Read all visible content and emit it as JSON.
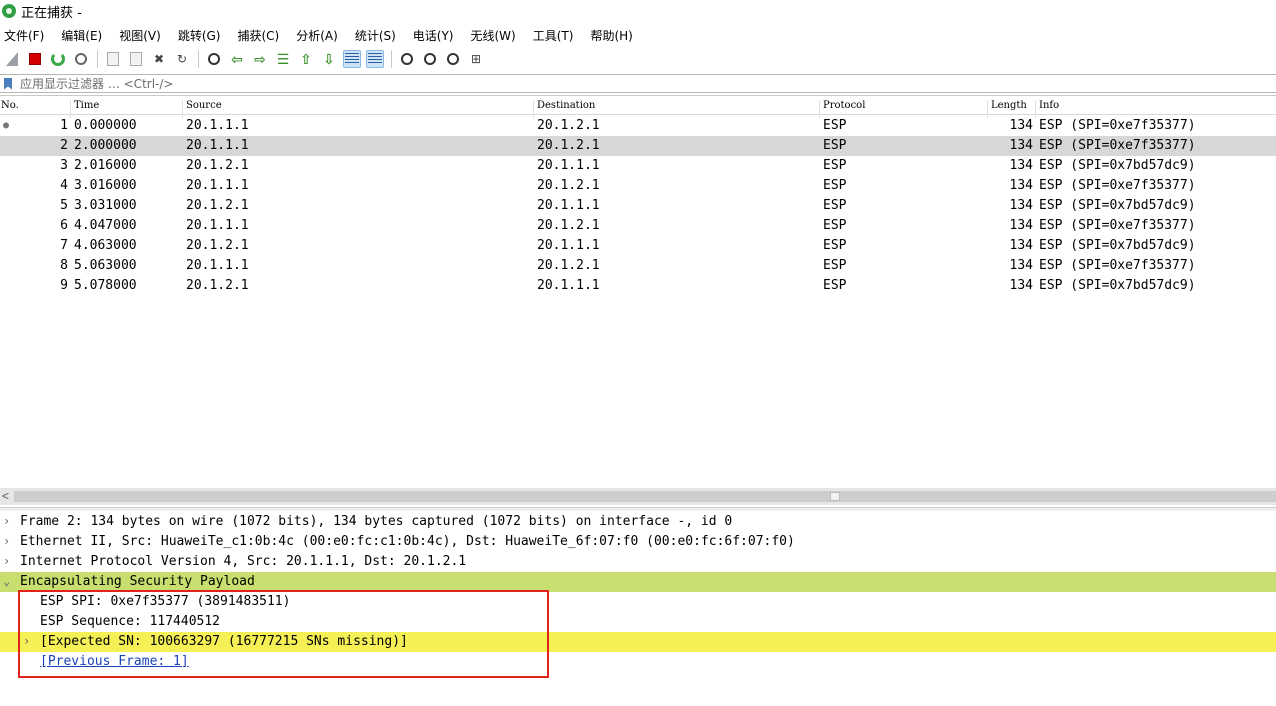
{
  "window": {
    "title": "正在捕获 -"
  },
  "menu": [
    "文件(F)",
    "编辑(E)",
    "视图(V)",
    "跳转(G)",
    "捕获(C)",
    "分析(A)",
    "统计(S)",
    "电话(Y)",
    "无线(W)",
    "工具(T)",
    "帮助(H)"
  ],
  "toolbar": {
    "icons": [
      "shark-fin-icon",
      "stop-capture-icon",
      "restart-capture-icon",
      "capture-options-icon",
      "open-file-icon",
      "save-file-icon",
      "close-file-icon",
      "reload-file-icon",
      "find-packet-icon",
      "go-back-icon",
      "go-forward-icon",
      "go-to-packet-icon",
      "go-first-icon",
      "go-last-icon",
      "auto-scroll-icon",
      "colorize-icon",
      "zoom-in-icon",
      "zoom-out-icon",
      "normal-size-icon",
      "resize-columns-icon"
    ]
  },
  "filter": {
    "placeholder": "应用显示过滤器 … <Ctrl-/>"
  },
  "packet_list": {
    "columns": [
      "No.",
      "Time",
      "Source",
      "Destination",
      "Protocol",
      "Length",
      "Info"
    ],
    "rows": [
      {
        "no": "1",
        "time": "0.000000",
        "source": "20.1.1.1",
        "destination": "20.1.2.1",
        "protocol": "ESP",
        "length": "134",
        "info": "ESP (SPI=0xe7f35377)"
      },
      {
        "no": "2",
        "time": "2.000000",
        "source": "20.1.1.1",
        "destination": "20.1.2.1",
        "protocol": "ESP",
        "length": "134",
        "info": "ESP (SPI=0xe7f35377)"
      },
      {
        "no": "3",
        "time": "2.016000",
        "source": "20.1.2.1",
        "destination": "20.1.1.1",
        "protocol": "ESP",
        "length": "134",
        "info": "ESP (SPI=0x7bd57dc9)"
      },
      {
        "no": "4",
        "time": "3.016000",
        "source": "20.1.1.1",
        "destination": "20.1.2.1",
        "protocol": "ESP",
        "length": "134",
        "info": "ESP (SPI=0xe7f35377)"
      },
      {
        "no": "5",
        "time": "3.031000",
        "source": "20.1.2.1",
        "destination": "20.1.1.1",
        "protocol": "ESP",
        "length": "134",
        "info": "ESP (SPI=0x7bd57dc9)"
      },
      {
        "no": "6",
        "time": "4.047000",
        "source": "20.1.1.1",
        "destination": "20.1.2.1",
        "protocol": "ESP",
        "length": "134",
        "info": "ESP (SPI=0xe7f35377)"
      },
      {
        "no": "7",
        "time": "4.063000",
        "source": "20.1.2.1",
        "destination": "20.1.1.1",
        "protocol": "ESP",
        "length": "134",
        "info": "ESP (SPI=0x7bd57dc9)"
      },
      {
        "no": "8",
        "time": "5.063000",
        "source": "20.1.1.1",
        "destination": "20.1.2.1",
        "protocol": "ESP",
        "length": "134",
        "info": "ESP (SPI=0xe7f35377)"
      },
      {
        "no": "9",
        "time": "5.078000",
        "source": "20.1.2.1",
        "destination": "20.1.1.1",
        "protocol": "ESP",
        "length": "134",
        "info": "ESP (SPI=0x7bd57dc9)"
      }
    ],
    "selected_no": "2"
  },
  "details": {
    "frame": "Frame 2: 134 bytes on wire (1072 bits), 134 bytes captured (1072 bits) on interface -, id 0",
    "ethernet": "Ethernet II, Src: HuaweiTe_c1:0b:4c (00:e0:fc:c1:0b:4c), Dst: HuaweiTe_6f:07:f0 (00:e0:fc:6f:07:f0)",
    "ip": "Internet Protocol Version 4, Src: 20.1.1.1, Dst: 20.1.2.1",
    "esp": "Encapsulating Security Payload",
    "esp_spi": "ESP SPI: 0xe7f35377 (3891483511)",
    "esp_seq": "ESP Sequence: 117440512",
    "expected_sn": "[Expected SN: 100663297 (16777215 SNs missing)]",
    "previous_frame": "[Previous Frame: 1]"
  },
  "colors": {
    "selected_row": "#d7d7d7",
    "esp_highlight": "#c8df6f",
    "warning_highlight": "#f5f055",
    "annotation_box": "#e0231c",
    "link": "#1a42b8"
  }
}
